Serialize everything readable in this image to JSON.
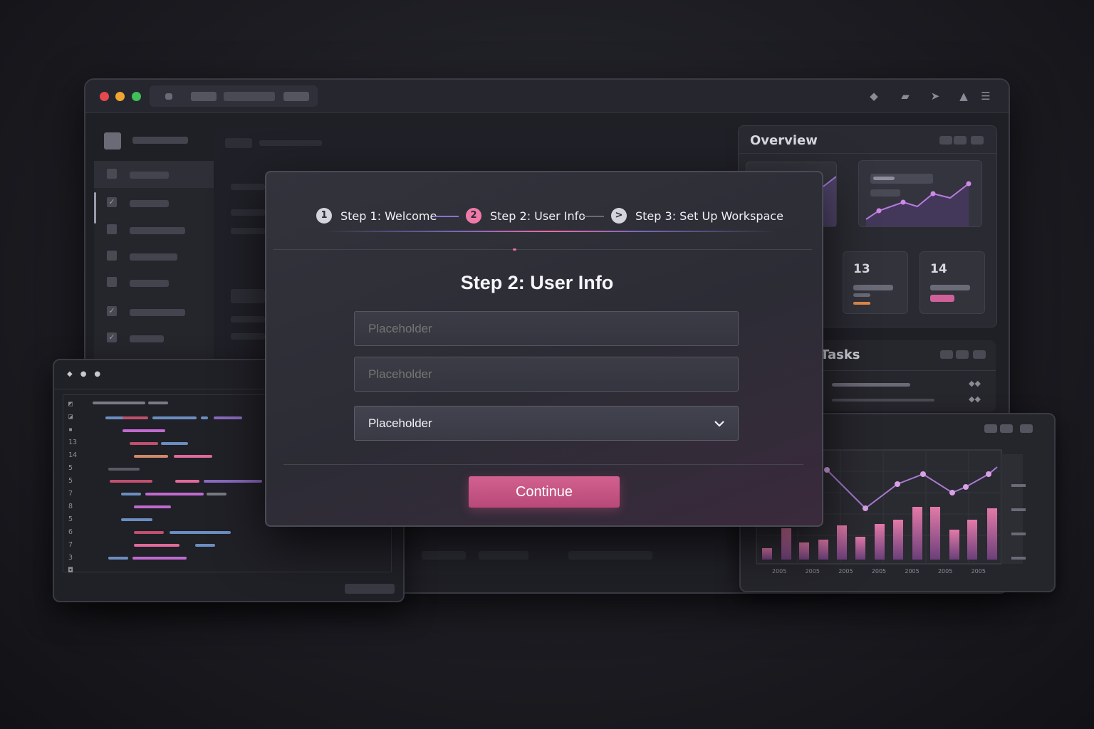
{
  "modal": {
    "steps": [
      {
        "number": "1",
        "label": "Step 1: Welcome"
      },
      {
        "number": "2",
        "label": "Step 2: User Info"
      },
      {
        "number": ">",
        "label": "Step 3: Set Up Workspace"
      }
    ],
    "title": "Step 2: User Info",
    "fields": [
      {
        "placeholder": "Placeholder"
      },
      {
        "placeholder": "Placeholder"
      }
    ],
    "select": {
      "value": "Placeholder"
    },
    "continue_label": "Continue"
  },
  "overview": {
    "title": "Overview",
    "cards": [
      {
        "value": "13"
      },
      {
        "value": "14"
      }
    ]
  },
  "tasks": {
    "title": "Tasks"
  },
  "code": {
    "line_numbers": [
      "13",
      "14",
      "5",
      "5",
      "7",
      "8",
      "5",
      "6",
      "7",
      "3"
    ]
  },
  "chart": {
    "x_labels": [
      "2005",
      "2005",
      "2005",
      "2005",
      "2005",
      "2005",
      "2005"
    ]
  },
  "colors": {
    "accent": "#c9568a",
    "background": "#1c1c22"
  }
}
